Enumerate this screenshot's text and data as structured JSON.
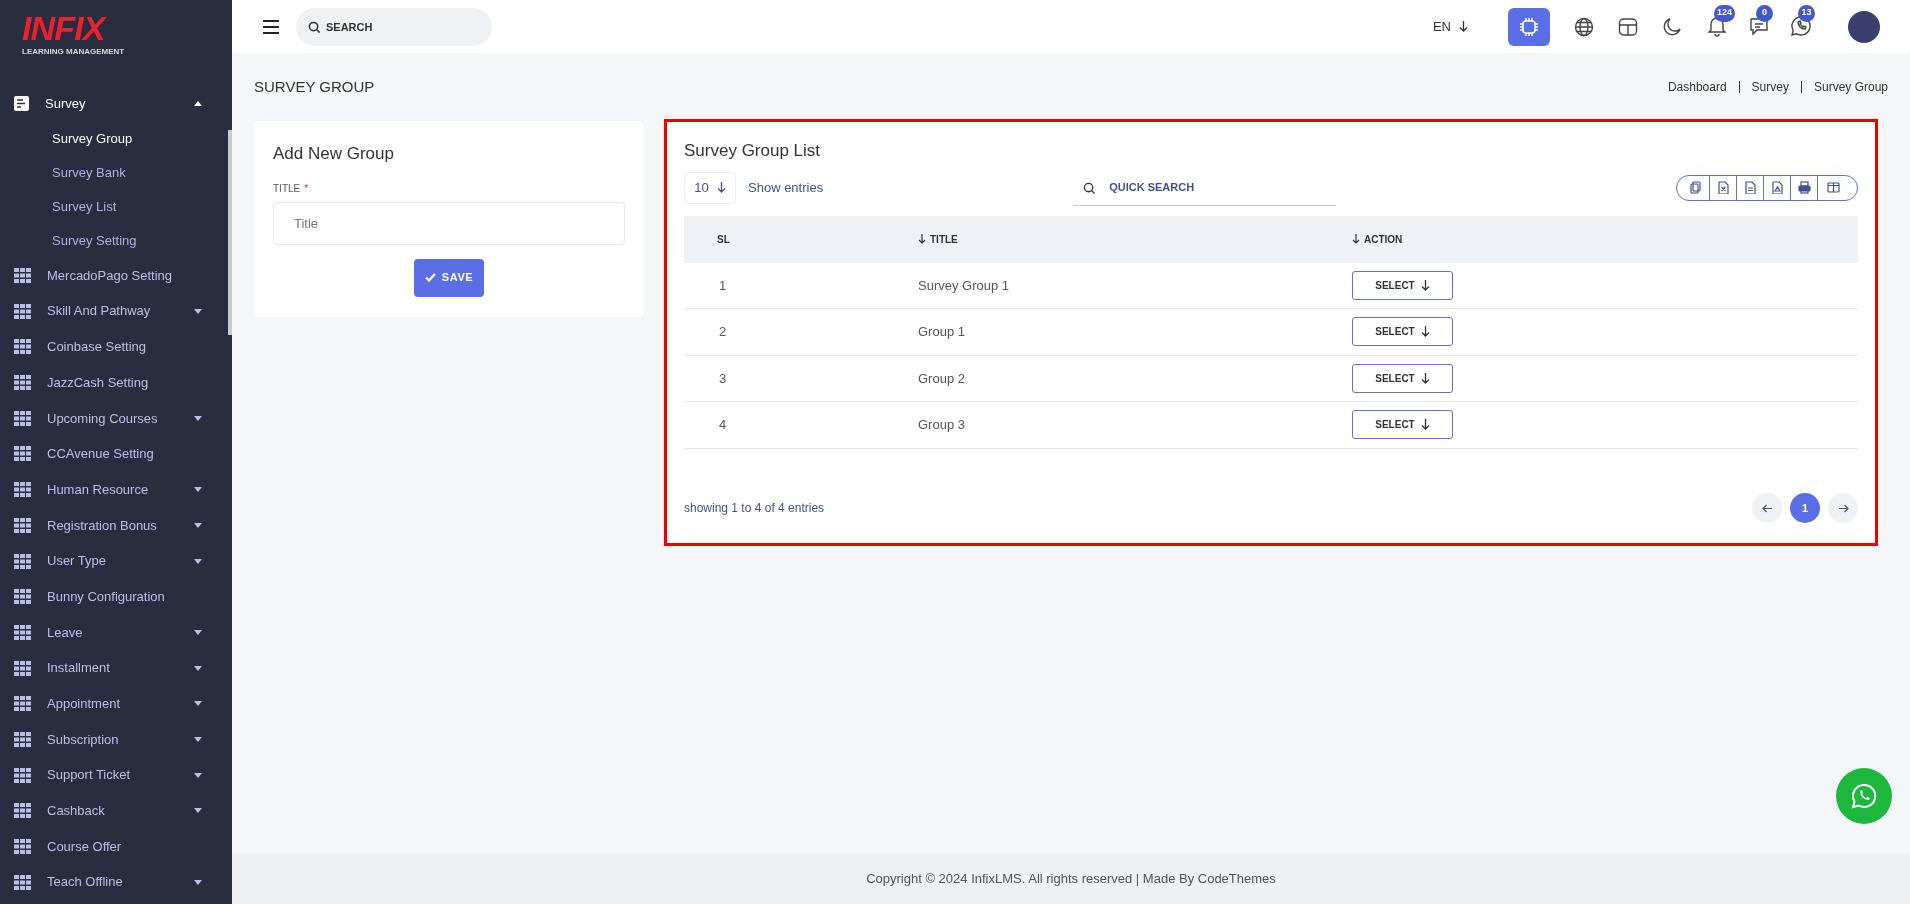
{
  "brand": {
    "logo": "INFIX",
    "tagline": "LEARNING MANAGEMENT"
  },
  "sidebar": {
    "items": [
      {
        "label": "Survey",
        "kind": "menu",
        "expanded": true,
        "children": [
          {
            "label": "Survey Group",
            "selected": true
          },
          {
            "label": "Survey Bank",
            "selected": false
          },
          {
            "label": "Survey List",
            "selected": false
          },
          {
            "label": "Survey Setting",
            "selected": false
          }
        ]
      },
      {
        "label": "MercadoPago Setting",
        "kind": "link"
      },
      {
        "label": "Skill And Pathway",
        "kind": "menu",
        "expanded": false
      },
      {
        "label": "Coinbase Setting",
        "kind": "link"
      },
      {
        "label": "JazzCash Setting",
        "kind": "link"
      },
      {
        "label": "Upcoming Courses",
        "kind": "menu",
        "expanded": false
      },
      {
        "label": "CCAvenue Setting",
        "kind": "link"
      },
      {
        "label": "Human Resource",
        "kind": "menu",
        "expanded": false
      },
      {
        "label": "Registration Bonus",
        "kind": "menu",
        "expanded": false
      },
      {
        "label": "User Type",
        "kind": "menu",
        "expanded": false
      },
      {
        "label": "Bunny Configuration",
        "kind": "link"
      },
      {
        "label": "Leave",
        "kind": "menu",
        "expanded": false
      },
      {
        "label": "Installment",
        "kind": "menu",
        "expanded": false
      },
      {
        "label": "Appointment",
        "kind": "menu",
        "expanded": false
      },
      {
        "label": "Subscription",
        "kind": "menu",
        "expanded": false
      },
      {
        "label": "Support Ticket",
        "kind": "menu",
        "expanded": false
      },
      {
        "label": "Cashback",
        "kind": "menu",
        "expanded": false
      },
      {
        "label": "Course Offer",
        "kind": "link"
      },
      {
        "label": "Teach Offline",
        "kind": "menu",
        "expanded": false
      }
    ]
  },
  "topbar": {
    "search": {
      "placeholder": "SEARCH"
    },
    "language": "EN",
    "notifications": [
      {
        "kind": "bell",
        "count": "124"
      },
      {
        "kind": "chat",
        "count": "0"
      },
      {
        "kind": "whatsapp",
        "count": "13"
      }
    ]
  },
  "page": {
    "title": "SURVEY GROUP",
    "breadcrumb": [
      "Dashboard",
      "Survey",
      "Survey Group"
    ]
  },
  "form": {
    "title": "Add New Group",
    "field_label": "TITLE",
    "required_mark": "*",
    "placeholder": "Title",
    "save": "SAVE"
  },
  "list": {
    "title": "Survey Group List",
    "page_size": "10",
    "show_entries": "Show entries",
    "search_placeholder": "QUICK SEARCH",
    "highlighted": true,
    "columns": [
      {
        "label": "SL",
        "sortable": false
      },
      {
        "label": "TITLE",
        "sortable": true
      },
      {
        "label": "ACTION",
        "sortable": true
      }
    ],
    "rows": [
      {
        "sl": "1",
        "title": "Survey Group 1",
        "action": "SELECT"
      },
      {
        "sl": "2",
        "title": "Group 1",
        "action": "SELECT"
      },
      {
        "sl": "3",
        "title": "Group 2",
        "action": "SELECT"
      },
      {
        "sl": "4",
        "title": "Group 3",
        "action": "SELECT"
      }
    ],
    "summary": "showing 1 to 4 of 4 entries",
    "pages": [
      {
        "label": "1",
        "selected": true
      }
    ]
  },
  "footer": "Copyright © 2024 InfixLMS. All rights reserved | Made By CodeThemes"
}
